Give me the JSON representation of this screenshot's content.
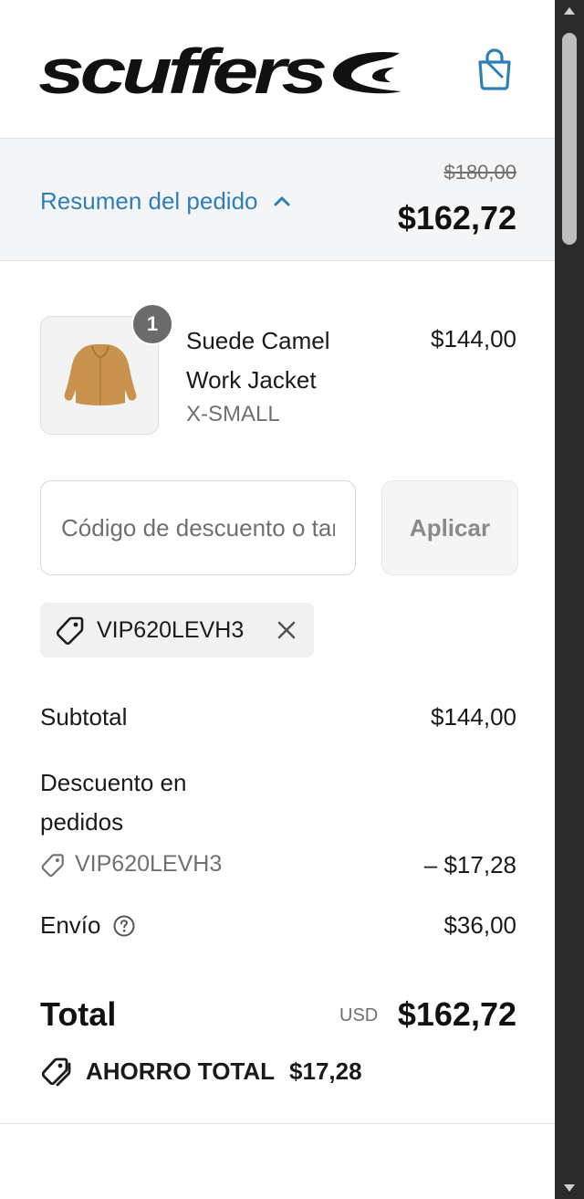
{
  "header": {
    "logo_text": "scuffers",
    "cart_icon": "shopping-bag-icon"
  },
  "summary": {
    "toggle_label": "Resumen del pedido",
    "toggle_icon": "chevron-up-icon",
    "compare_price": "$180,00",
    "price": "$162,72"
  },
  "product": {
    "quantity": "1",
    "name": "Suede Camel Work Jacket",
    "variant": "X-SMALL",
    "price": "$144,00",
    "image_icon": "jacket-image"
  },
  "discount": {
    "placeholder": "Código de descuento o tarjeta de regalo",
    "apply_label": "Aplicar",
    "applied_code": "VIP620LEVH3",
    "remove_icon": "close-icon"
  },
  "totals": {
    "subtotal_label": "Subtotal",
    "subtotal_value": "$144,00",
    "discount_label": "Descuento en pedidos",
    "discount_code": "VIP620LEVH3",
    "discount_value": "– $17,28",
    "shipping_label": "Envío",
    "shipping_value": "$36,00",
    "total_label": "Total",
    "currency": "USD",
    "total_value": "$162,72",
    "savings_label": "AHORRO TOTAL",
    "savings_value": "$17,28"
  },
  "colors": {
    "link": "#2f7fb6",
    "summary_bg": "#f4f5f6",
    "badge": "#6b6b6b"
  }
}
